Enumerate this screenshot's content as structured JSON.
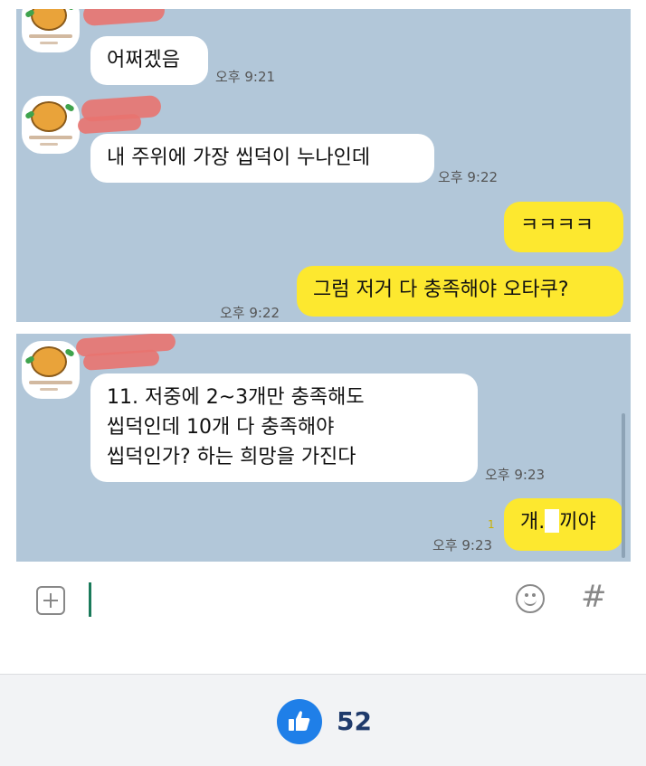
{
  "panel1": {
    "messages": [
      {
        "side": "in",
        "text": "어쩌겠음",
        "time": "오후 9:21"
      },
      {
        "side": "in",
        "text": "내 주위에 가장 씹덕이 누나인데",
        "time": "오후 9:22"
      },
      {
        "side": "out",
        "text": "ㅋㅋㅋㅋ"
      },
      {
        "side": "out",
        "text": "그럼 저거 다 충족해야 오타쿠?",
        "time": "오후 9:22"
      }
    ]
  },
  "panel2": {
    "incoming": {
      "lines": [
        "11. 저중에 2~3개만 충족해도",
        "씹덕인데 10개 다 충족해야",
        "씹덕인가? 하는 희망을 가진다"
      ],
      "time": "오후 9:23"
    },
    "outgoing": {
      "text_start": "개",
      "text_end": "끼야",
      "unread": "1",
      "time": "오후 9:23"
    }
  },
  "input_bar": {
    "icons": [
      "plus-icon",
      "emoji-icon",
      "hash-icon"
    ],
    "hash": "#"
  },
  "reaction": {
    "icon": "thumbs-up-icon",
    "count": "52",
    "accent": "#1f7fe8"
  }
}
